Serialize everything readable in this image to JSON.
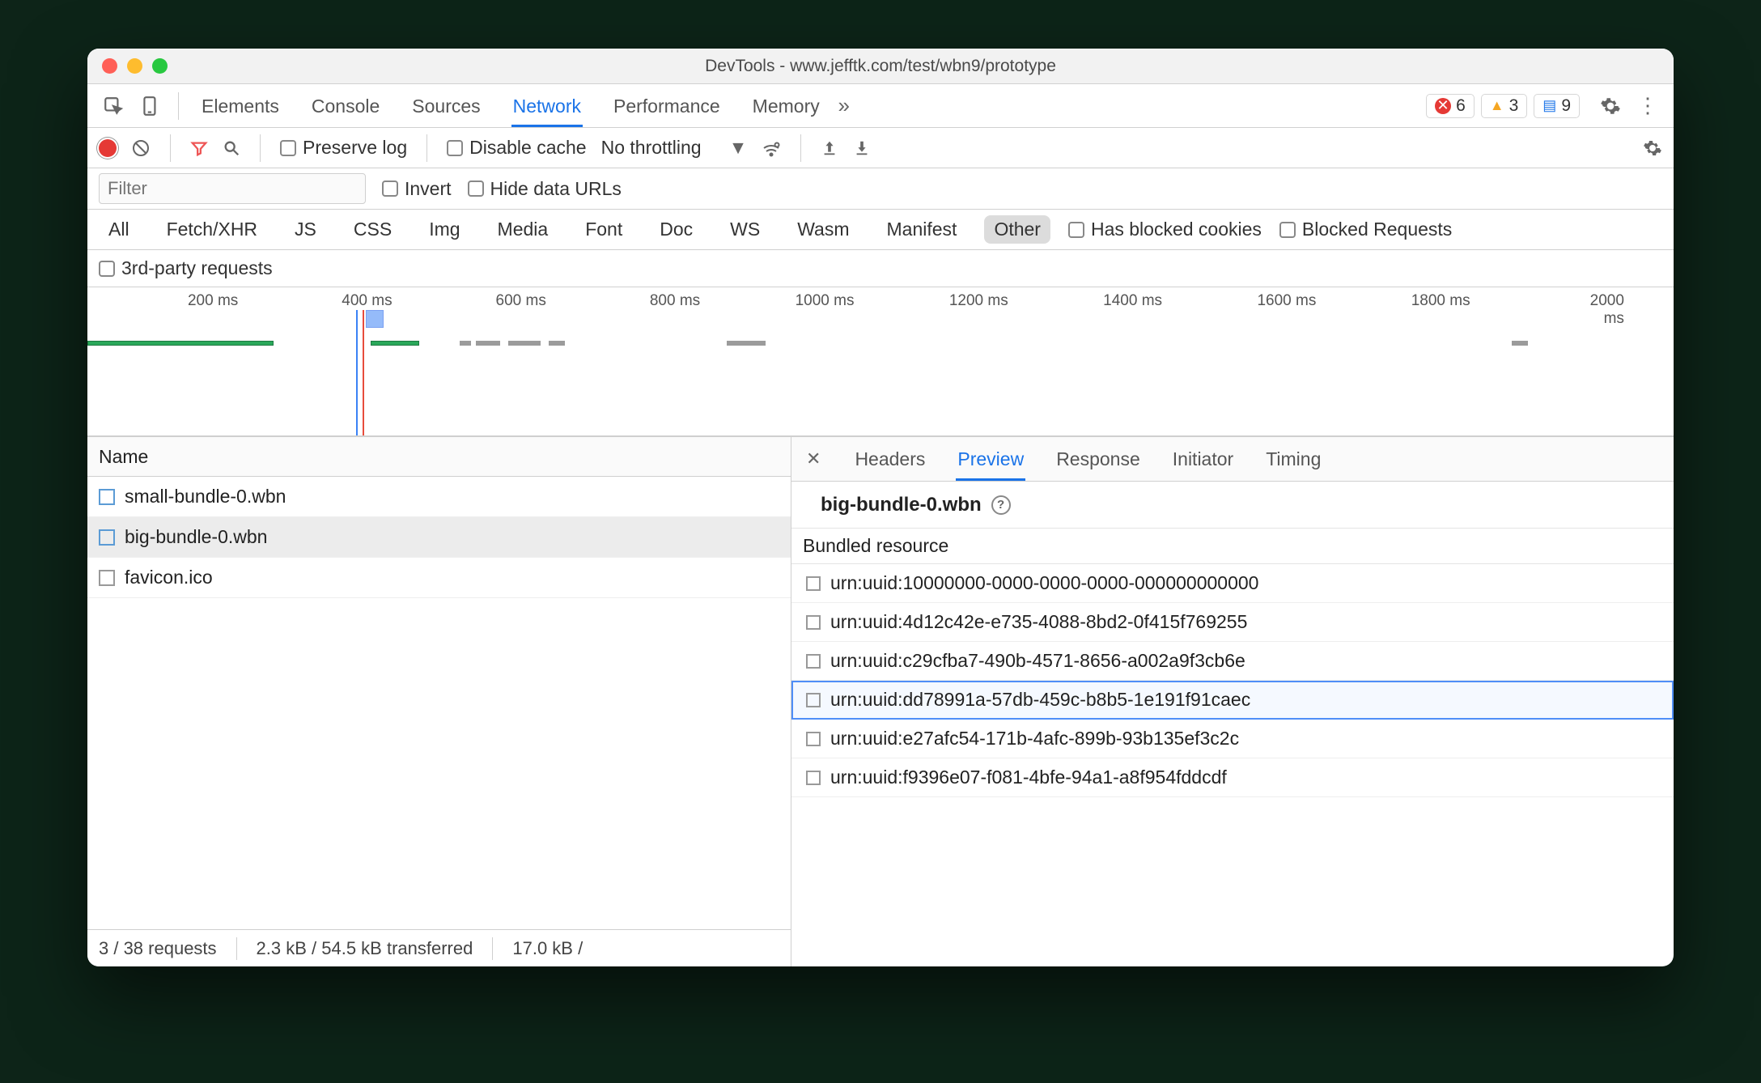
{
  "window": {
    "title": "DevTools - www.jefftk.com/test/wbn9/prototype"
  },
  "tabs": {
    "items": [
      "Elements",
      "Console",
      "Sources",
      "Network",
      "Performance",
      "Memory"
    ],
    "active": "Network",
    "more_icon": "»"
  },
  "badges": {
    "errors": "6",
    "warnings": "3",
    "messages": "9"
  },
  "toolbar": {
    "preserve_log": "Preserve log",
    "disable_cache": "Disable cache",
    "throttling": "No throttling"
  },
  "filter": {
    "placeholder": "Filter",
    "invert": "Invert",
    "hide_data_urls": "Hide data URLs"
  },
  "type_filters": {
    "items": [
      "All",
      "Fetch/XHR",
      "JS",
      "CSS",
      "Img",
      "Media",
      "Font",
      "Doc",
      "WS",
      "Wasm",
      "Manifest",
      "Other"
    ],
    "active": "Other",
    "has_blocked_cookies": "Has blocked cookies",
    "blocked_requests": "Blocked Requests",
    "third_party": "3rd-party requests"
  },
  "timeline": {
    "ticks": [
      "200 ms",
      "400 ms",
      "600 ms",
      "800 ms",
      "1000 ms",
      "1200 ms",
      "1400 ms",
      "1600 ms",
      "1800 ms",
      "2000 ms"
    ]
  },
  "requests": {
    "header": "Name",
    "items": [
      {
        "name": "small-bundle-0.wbn",
        "icon": "doc",
        "selected": false
      },
      {
        "name": "big-bundle-0.wbn",
        "icon": "doc",
        "selected": true
      },
      {
        "name": "favicon.ico",
        "icon": "file",
        "selected": false
      }
    ]
  },
  "status": {
    "requests": "3 / 38 requests",
    "transferred": "2.3 kB / 54.5 kB transferred",
    "resources": "17.0 kB /"
  },
  "detail": {
    "tabs": [
      "Headers",
      "Preview",
      "Response",
      "Initiator",
      "Timing"
    ],
    "active": "Preview",
    "title": "big-bundle-0.wbn",
    "section": "Bundled resource",
    "resources": [
      {
        "name": "urn:uuid:10000000-0000-0000-0000-000000000000",
        "selected": false
      },
      {
        "name": "urn:uuid:4d12c42e-e735-4088-8bd2-0f415f769255",
        "selected": false
      },
      {
        "name": "urn:uuid:c29cfba7-490b-4571-8656-a002a9f3cb6e",
        "selected": false
      },
      {
        "name": "urn:uuid:dd78991a-57db-459c-b8b5-1e191f91caec",
        "selected": true
      },
      {
        "name": "urn:uuid:e27afc54-171b-4afc-899b-93b135ef3c2c",
        "selected": false
      },
      {
        "name": "urn:uuid:f9396e07-f081-4bfe-94a1-a8f954fddcdf",
        "selected": false
      }
    ]
  }
}
